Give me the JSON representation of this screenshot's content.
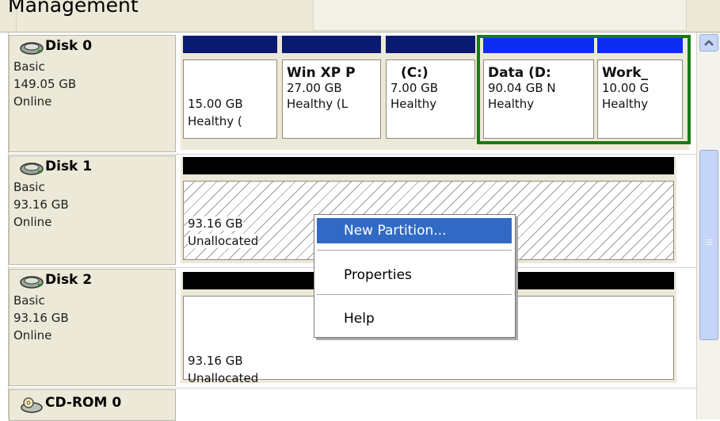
{
  "window_title_partial": "Management",
  "disks": [
    {
      "name": "Disk 0",
      "type": "Basic",
      "size": "149.05 GB",
      "status": "Online",
      "partitions": [
        {
          "label": "",
          "size": "15.00 GB",
          "status": "Healthy (",
          "bar": "#0a1a6e"
        },
        {
          "label": "Win XP P",
          "size": "27.00 GB",
          "status": "Healthy (L",
          "bar": "#0a1a6e"
        },
        {
          "label": "(C:)",
          "size": "7.00 GB",
          "status": "Healthy",
          "bar": "#0a1a6e"
        },
        {
          "label": "Data  (D:",
          "size": "90.04 GB N",
          "status": "Healthy",
          "bar": "#0d2cf0"
        },
        {
          "label": "Work_",
          "size": "10.00 G",
          "status": "Healthy",
          "bar": "#0d2cf0"
        }
      ]
    },
    {
      "name": "Disk 1",
      "type": "Basic",
      "size": "93.16 GB",
      "status": "Online",
      "partitions": [
        {
          "size": "93.16 GB",
          "status": "Unallocated",
          "bar": "#000000"
        }
      ]
    },
    {
      "name": "Disk 2",
      "type": "Basic",
      "size": "93.16 GB",
      "status": "Online",
      "partitions": [
        {
          "size": "93.16 GB",
          "status": "Unallocated",
          "bar": "#000000"
        }
      ]
    },
    {
      "name": "CD-ROM 0"
    }
  ],
  "context_menu": {
    "items": [
      "New Partition...",
      "Properties",
      "Help"
    ],
    "selected": "New Partition..."
  },
  "colors": {
    "selection_frame": "#1b7a16",
    "menu_highlight": "#316ac5",
    "panel_bg": "#ece9d8"
  }
}
